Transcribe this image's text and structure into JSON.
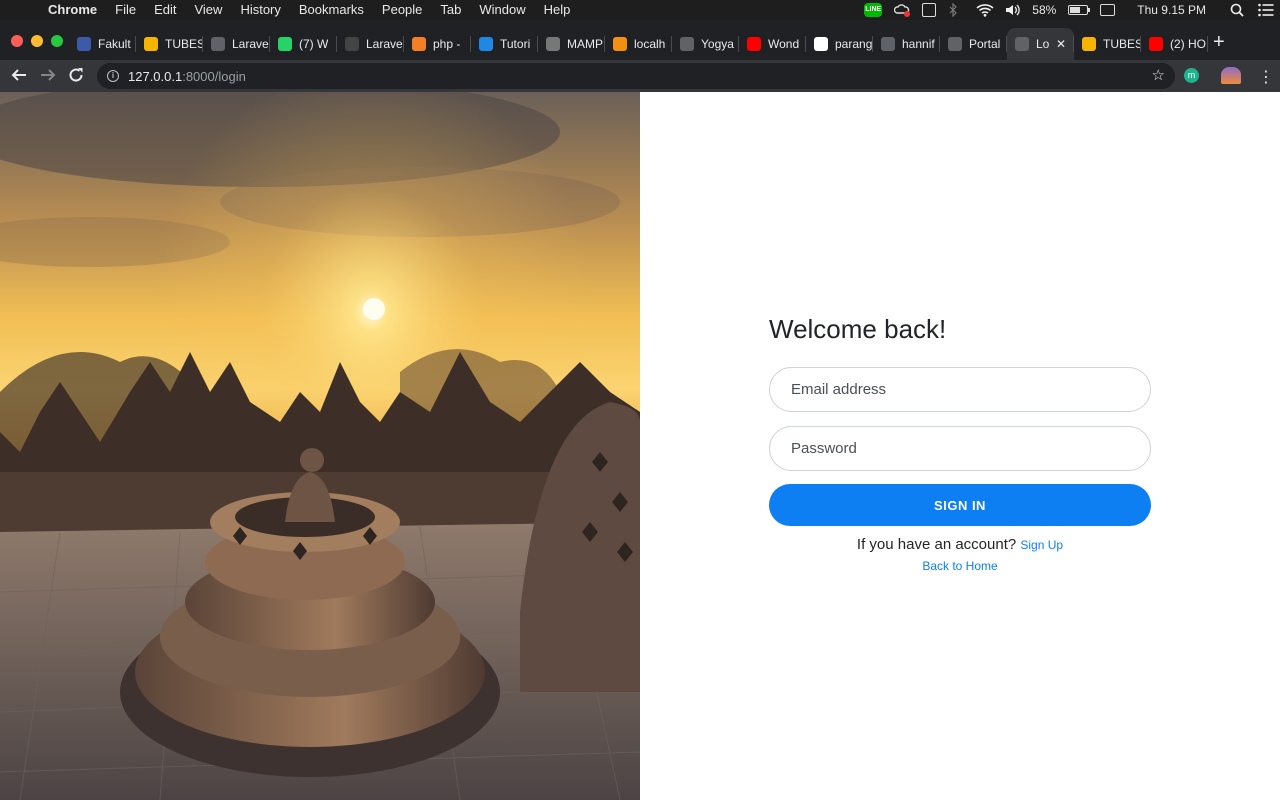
{
  "menubar": {
    "app_name": "Chrome",
    "items": [
      "File",
      "Edit",
      "View",
      "History",
      "Bookmarks",
      "People",
      "Tab",
      "Window",
      "Help"
    ],
    "battery_percent": "58%",
    "battery_level": 0.58,
    "clock": "Thu 9.15 PM"
  },
  "tabs": [
    {
      "title": "Fakult",
      "favicon": "school-icon",
      "color": "#3b5aa8"
    },
    {
      "title": "TUBES",
      "favicon": "google-drive-icon",
      "color": "#f4b400"
    },
    {
      "title": "Larave",
      "favicon": "globe-icon",
      "color": "#5f6368"
    },
    {
      "title": "(7) W",
      "favicon": "whatsapp-icon",
      "color": "#25d366"
    },
    {
      "title": "Larave",
      "favicon": "tm-icon",
      "color": "#444"
    },
    {
      "title": "php -",
      "favicon": "stackoverflow-icon",
      "color": "#f48024"
    },
    {
      "title": "Tutori",
      "favicon": "tutorial-icon",
      "color": "#1e88e5"
    },
    {
      "title": "MAMP",
      "favicon": "elephant-icon",
      "color": "#777"
    },
    {
      "title": "localh",
      "favicon": "phpmyadmin-icon",
      "color": "#f29111"
    },
    {
      "title": "Yogya",
      "favicon": "globe-icon",
      "color": "#5f6368"
    },
    {
      "title": "Wond",
      "favicon": "youtube-icon",
      "color": "#ff0000"
    },
    {
      "title": "parang",
      "favicon": "google-icon",
      "color": "#fff"
    },
    {
      "title": "hannif",
      "favicon": "globe-icon",
      "color": "#5f6368"
    },
    {
      "title": "Portal",
      "favicon": "globe-icon",
      "color": "#5f6368"
    },
    {
      "title": "Lo",
      "favicon": "loading-icon",
      "color": "#5f6368",
      "active": true
    },
    {
      "title": "TUBES",
      "favicon": "google-drive-icon",
      "color": "#f4b400"
    },
    {
      "title": "(2) HO",
      "favicon": "youtube-icon",
      "color": "#ff0000"
    }
  ],
  "omnibox": {
    "host": "127.0.0.1",
    "path": ":8000/login"
  },
  "extensions": {
    "ext1_letter": "m"
  },
  "login": {
    "heading": "Welcome back!",
    "email_placeholder": "Email address",
    "password_placeholder": "Password",
    "signin_label": "SIGN IN",
    "account_prompt": "If you have an account?",
    "signup_link": "Sign Up",
    "back_home": "Back to Home"
  },
  "colors": {
    "accent": "#0d7ff2",
    "chrome_dark": "#202124",
    "chrome_toolbar": "#35363a"
  }
}
